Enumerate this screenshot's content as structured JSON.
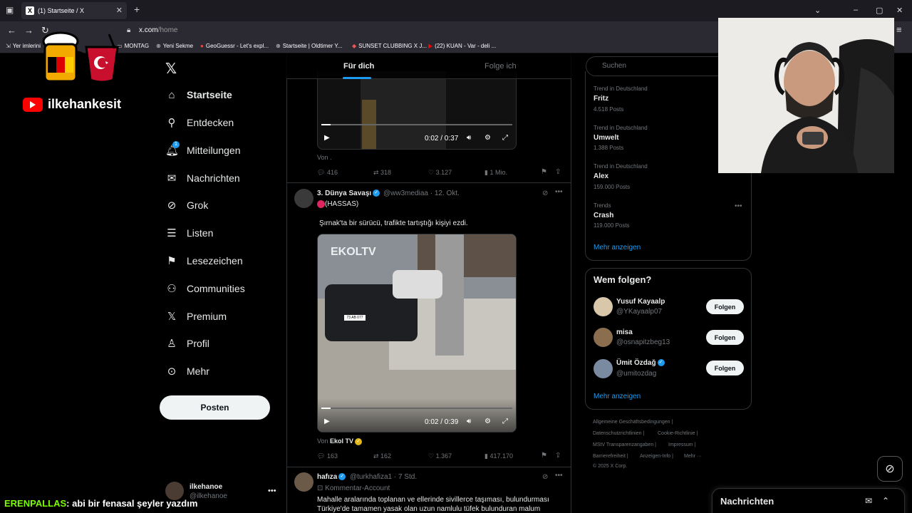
{
  "browser": {
    "tab_title": "(1) Startseite / X",
    "new_tab": "+",
    "url_host": "x.com",
    "url_path": "/home",
    "bookmarks": [
      "Yer imlerini",
      "MONTAG",
      "Yeni Sekme",
      "GeoGuessr - Let's expl...",
      "Startseite | Oldtimer Y...",
      "SUNSET CLUBBING X J...",
      "(22) KUAN - Var - deli ..."
    ]
  },
  "overlay": {
    "channel": "ilkehankesit",
    "chat_user": "ERENPALLAS",
    "chat_text": ": abi bir fenasal şeyler yazdım"
  },
  "sidebar": {
    "items": [
      {
        "label": "Startseite",
        "icon": "home-icon"
      },
      {
        "label": "Entdecken",
        "icon": "search-icon"
      },
      {
        "label": "Mitteilungen",
        "icon": "bell-icon",
        "badge": "1"
      },
      {
        "label": "Nachrichten",
        "icon": "mail-icon"
      },
      {
        "label": "Grok",
        "icon": "grok-icon"
      },
      {
        "label": "Listen",
        "icon": "list-icon"
      },
      {
        "label": "Lesezeichen",
        "icon": "bookmark-icon"
      },
      {
        "label": "Communities",
        "icon": "communities-icon"
      },
      {
        "label": "Premium",
        "icon": "x-icon"
      },
      {
        "label": "Profil",
        "icon": "profile-icon"
      },
      {
        "label": "Mehr",
        "icon": "more-icon"
      }
    ],
    "post_button": "Posten",
    "account_name": "ilkehanoe",
    "account_handle": "@ilkehanoe"
  },
  "feed": {
    "tabs": [
      "Für dich",
      "Folge ich"
    ],
    "tweet0": {
      "video_time": "0:02 / 0:37",
      "video_progress": 0.05,
      "source": "Von .",
      "replies": "416",
      "reposts": "318",
      "likes": "3.127",
      "views": "1 Mio."
    },
    "tweet1": {
      "name": "3. Dünya Savaşı",
      "handle": "@ww3mediaa",
      "time": "· 12. Okt.",
      "label": "(HASSAS)",
      "text": "Şırnak'ta bir sürücü, trafikte tartıştığı kişiyi ezdi.",
      "video_brand": "EKOLTV",
      "plate": "73 AB 077",
      "video_time": "0:02 / 0:39",
      "video_progress": 0.05,
      "source_prefix": "Von",
      "source_name": "Ekol TV",
      "replies": "163",
      "reposts": "162",
      "likes": "1.367",
      "views": "417.170"
    },
    "tweet2": {
      "name": "hafıza",
      "handle": "@turkhafiza1",
      "time": "· 7 Std.",
      "label": "Kommentar-Account",
      "line1": "Mahalle aralarında toplanan ve ellerinde sivillerce taşıması, bulundurması",
      "line2": "Türkiye'de tamamen yasak olan uzun namlulu tüfek bulunduran malum"
    }
  },
  "right": {
    "search_placeholder": "Suchen",
    "trends": [
      {
        "category": "Trend in Deutschland",
        "name": "Fritz",
        "count": "4.518 Posts"
      },
      {
        "category": "Trend in Deutschland",
        "name": "Umwelt",
        "count": "1.388 Posts"
      },
      {
        "category": "Trend in Deutschland",
        "name": "Alex",
        "count": "159.000 Posts"
      },
      {
        "category": "Trends",
        "name": "Crash",
        "count": "119.000 Posts"
      }
    ],
    "trends_more": "Mehr anzeigen",
    "wtf_title": "Wem folgen?",
    "suggestions": [
      {
        "name": "Yusuf Kayaalp",
        "handle": "@YKayaalp07",
        "verified": false
      },
      {
        "name": "misa",
        "handle": "@osnapitzbeg13",
        "verified": false
      },
      {
        "name": "Ümit Özdağ",
        "handle": "@umitozdag",
        "verified": true
      }
    ],
    "follow_label": "Folgen",
    "wtf_more": "Mehr anzeigen",
    "footer": [
      "Allgemeine Geschäftsbedingungen",
      "Datenschutzrichtlinien",
      "Cookie-Richtlinie",
      "MStV Transparenzangaben",
      "Impressum",
      "Barrierefreiheit",
      "Anzeigen-Info",
      "Mehr ···",
      "© 2025 X Corp."
    ]
  },
  "messages_drawer": {
    "title": "Nachrichten"
  },
  "colors": {
    "accent": "#1d9bf0",
    "background": "#000000",
    "border": "#2f3336"
  }
}
